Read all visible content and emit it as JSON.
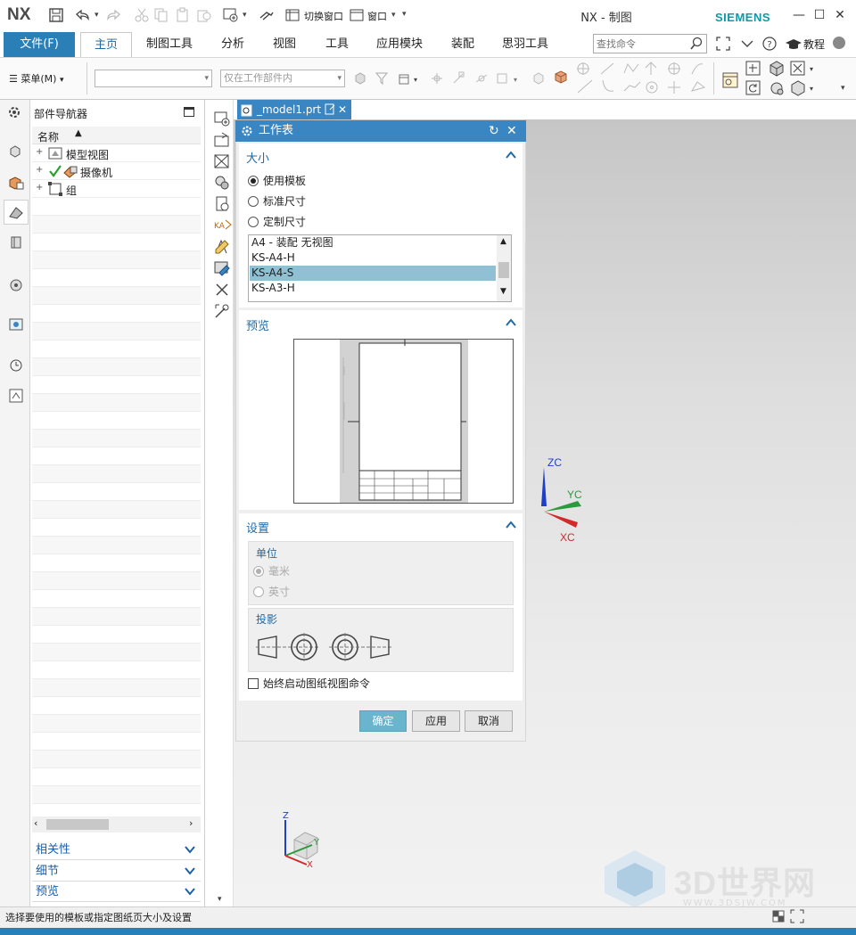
{
  "app": {
    "logo": "NX",
    "title": "NX - 制图",
    "brand": "SIEMENS"
  },
  "quick_access": {
    "switch_window": "切换窗口",
    "window": "窗口"
  },
  "ribbon": {
    "file": "文件(F)",
    "tabs": [
      "主页",
      "制图工具",
      "分析",
      "视图",
      "工具",
      "应用模块",
      "装配",
      "思羽工具"
    ],
    "search_placeholder": "查找命令",
    "tutorial": "教程"
  },
  "toolbar": {
    "menu": "菜单(M)",
    "filter_combo": "",
    "scope_combo": "仅在工作部件内"
  },
  "navigator": {
    "title": "部件导航器",
    "column": "名称",
    "rows": [
      "模型视图",
      "摄像机",
      "组"
    ],
    "panels": [
      "相关性",
      "细节",
      "预览"
    ]
  },
  "document_tab": "_model1.prt",
  "dialog": {
    "title": "工作表",
    "size_section": "大小",
    "radios": [
      "使用模板",
      "标准尺寸",
      "定制尺寸"
    ],
    "selected_radio": 0,
    "templates": [
      "A4 - 装配 无视图",
      "KS-A4-H",
      "KS-A4-S",
      "KS-A3-H"
    ],
    "selected_template": 2,
    "preview_section": "预览",
    "settings_section": "设置",
    "units_label": "单位",
    "units": [
      "毫米",
      "英寸"
    ],
    "projection_label": "投影",
    "always_start": "始终启动图纸视图命令",
    "ok": "确定",
    "apply": "应用",
    "cancel": "取消"
  },
  "triad": {
    "zc": "ZC",
    "yc": "YC",
    "xc": "XC",
    "z": "Z",
    "y": "Y",
    "x": "X"
  },
  "status_text": "选择要使用的模板或指定图纸页大小及设置",
  "watermark": {
    "main": "3D世界网",
    "sub": "WWW.3DSJW.COM"
  },
  "colors": {
    "accent": "#2b7fb7",
    "selected_row": "#8fc0d3",
    "ok_button": "#6bb4cd",
    "siemens": "#0c9aa5",
    "section_title": "#1f6aa5"
  }
}
